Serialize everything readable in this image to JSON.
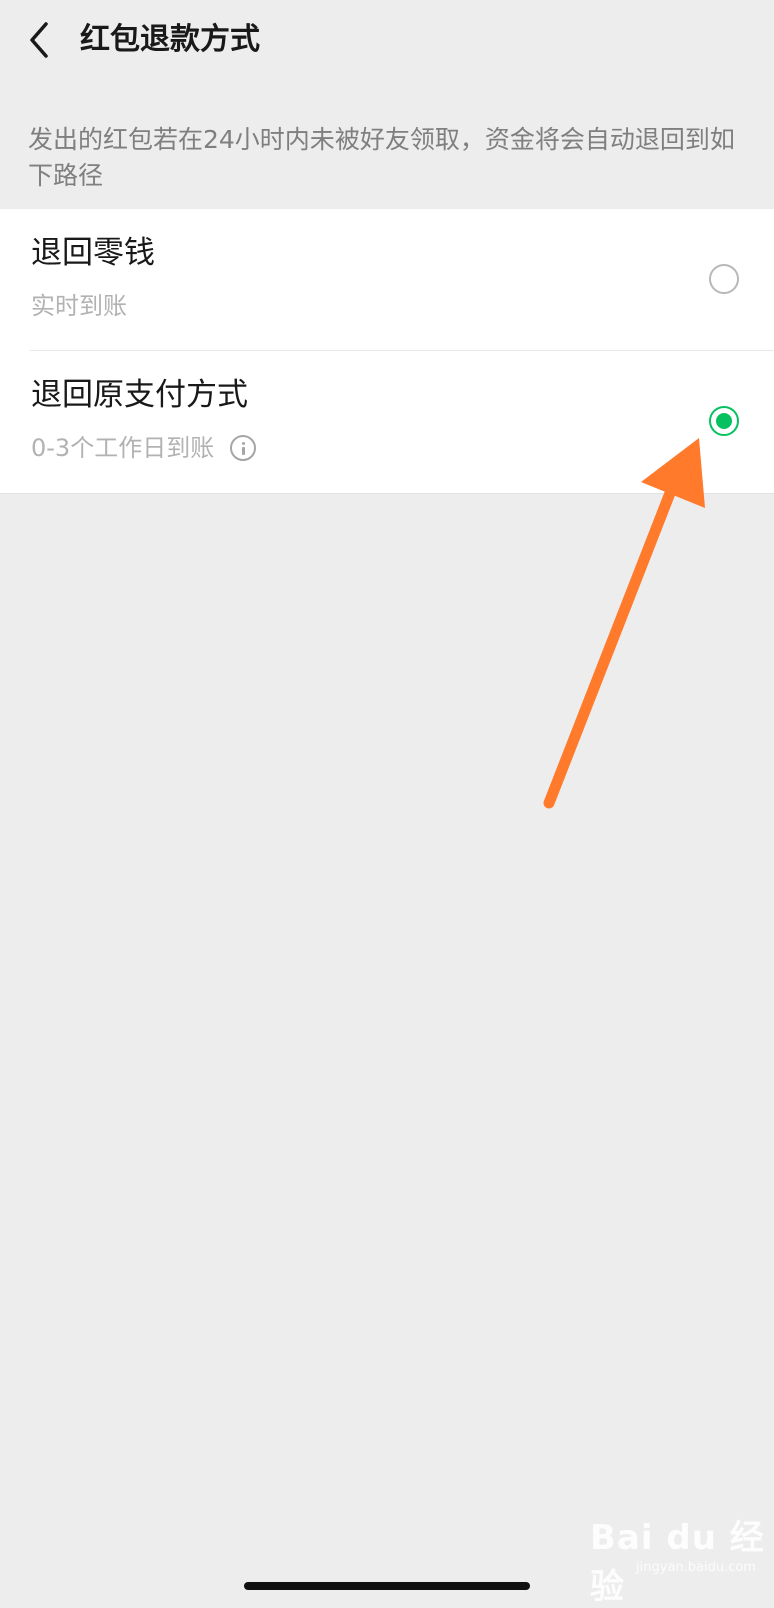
{
  "navbar": {
    "title": "红包退款方式",
    "back_icon": "chevron-left-icon"
  },
  "description": "发出的红包若在24小时内未被好友领取，资金将会自动退回到如下路径",
  "options": [
    {
      "title": "退回零钱",
      "subtitle": "实时到账",
      "selected": false
    },
    {
      "title": "退回原支付方式",
      "subtitle": "0-3个工作日到账",
      "info_icon": "info-icon",
      "selected": true
    }
  ],
  "annotation": {
    "icon": "orange-arrow-icon",
    "color": "#ff7a2b"
  },
  "watermark": {
    "brand": "Bai du 经验",
    "url": "jingyan.baidu.com"
  },
  "colors": {
    "accent": "#07c160",
    "background": "#ededed"
  }
}
